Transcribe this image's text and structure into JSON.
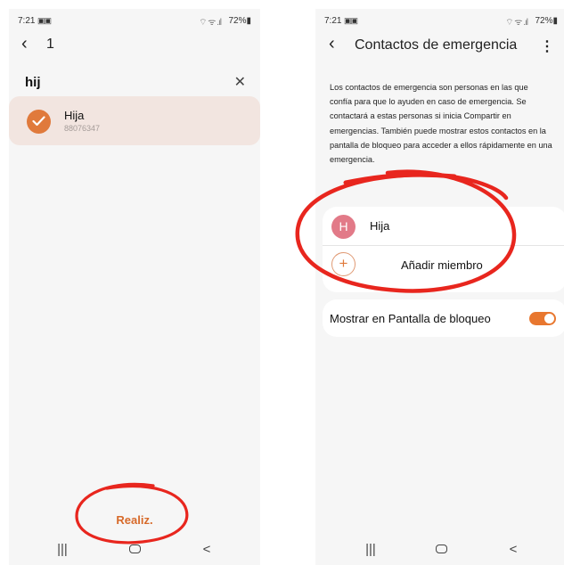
{
  "left_screen": {
    "status": {
      "time": "7:21",
      "sim_icon": "sim-card-icon",
      "signal": "⌔ ᯤ .ıl",
      "battery": "72%"
    },
    "header": {
      "back_icon": "chevron-left-icon",
      "selected_count": "1"
    },
    "search": {
      "value": "hij",
      "placeholder": "",
      "clear_icon": "close-icon"
    },
    "results": [
      {
        "name": "Hija",
        "number": "88076347",
        "selected": true
      }
    ],
    "done_label": "Realiz.",
    "nav": {
      "recents": "|||",
      "home": "home-icon",
      "back": "<"
    }
  },
  "right_screen": {
    "status": {
      "time": "7:21",
      "sim_icon": "sim-card-icon",
      "signal": "⌔ ᯤ .ıl",
      "battery": "72%"
    },
    "header": {
      "back_icon": "chevron-left-icon",
      "title": "Contactos de emergencia",
      "more_icon": "more-vertical-icon"
    },
    "description": "Los contactos de emergencia son personas en las que confía para que lo ayuden en caso de emergencia. Se contactará a estas personas si inicia Compartir en emergencias. También puede mostrar estos contactos en la pantalla de bloqueo para acceder a ellos rápidamente en una emergencia.",
    "contacts": [
      {
        "initial": "H",
        "name": "Hija",
        "avatar_color": "#e27a88"
      }
    ],
    "add_member_label": "Añadir miembro",
    "lock_screen": {
      "label": "Mostrar en Pantalla de bloqueo",
      "enabled": true
    },
    "nav": {
      "recents": "|||",
      "home": "home-icon",
      "back": "<"
    }
  },
  "colors": {
    "accent": "#e07a3c",
    "annotation": "#e8261e",
    "selected_row": "#f2e5e0",
    "avatar": "#e27a88"
  }
}
